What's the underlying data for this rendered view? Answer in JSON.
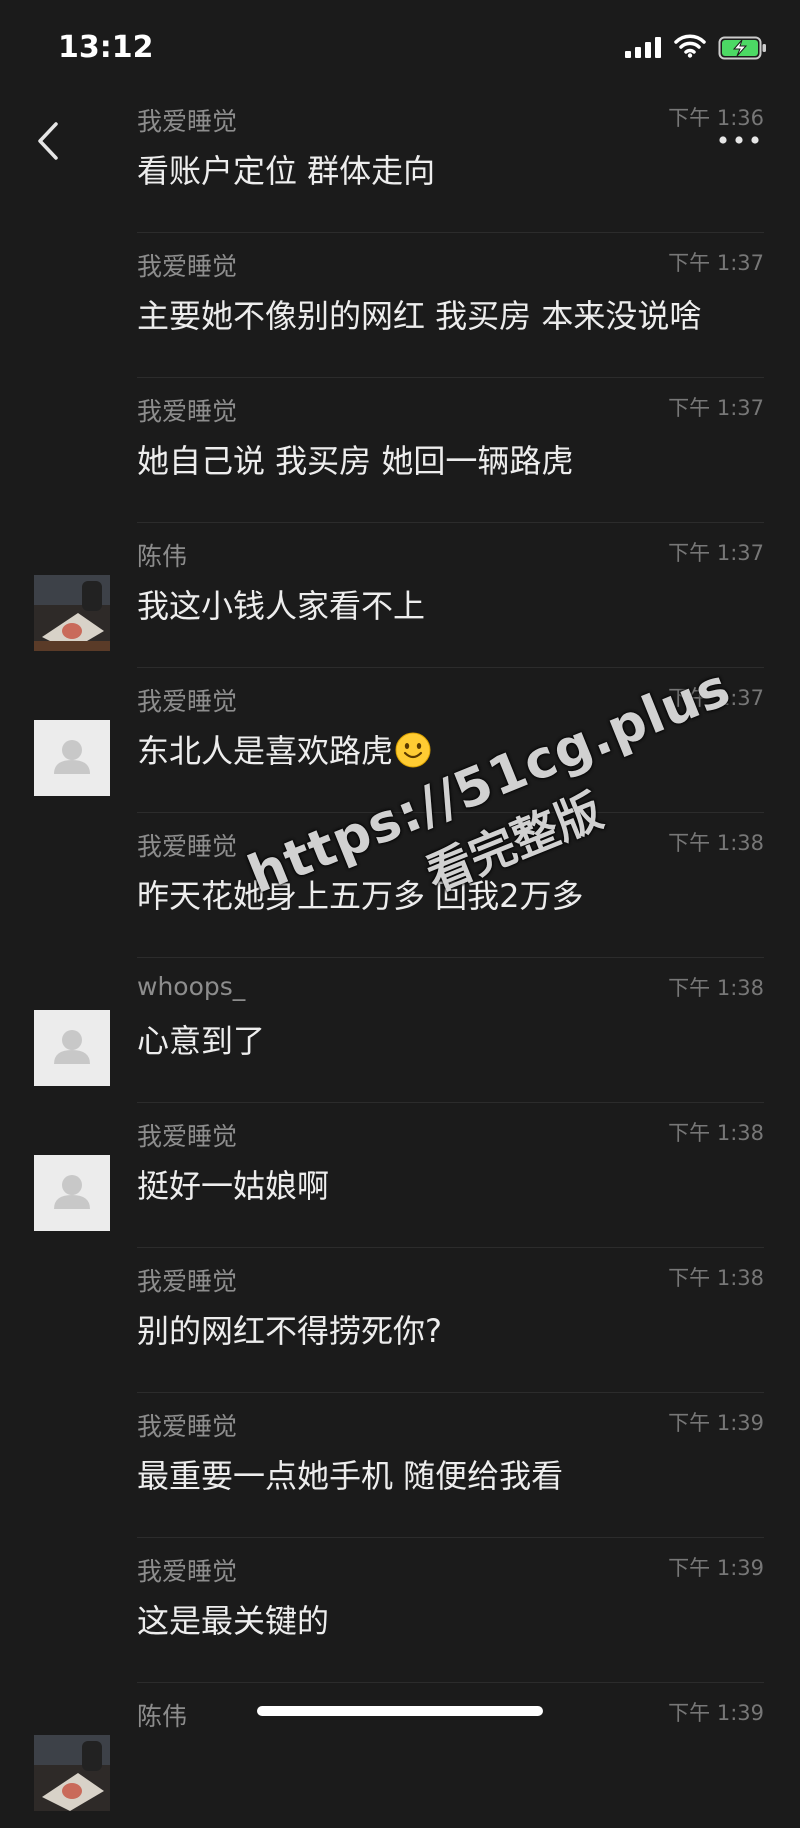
{
  "status_bar": {
    "time": "13:12"
  },
  "header": {
    "back_icon": "chevron-left-icon",
    "more_icon": "more-horizontal-icon"
  },
  "messages": [
    {
      "sender": "我爱睡觉",
      "time": "下午 1:36",
      "text": "看账户定位 群体走向",
      "avatar": "none"
    },
    {
      "sender": "我爱睡觉",
      "time": "下午 1:37",
      "text": "主要她不像别的网红 我买房 本来没说啥",
      "avatar": "none"
    },
    {
      "sender": "我爱睡觉",
      "time": "下午 1:37",
      "text": "她自己说 我买房 她回一辆路虎",
      "avatar": "none"
    },
    {
      "sender": "陈伟",
      "time": "下午 1:37",
      "text": "我这小钱人家看不上",
      "avatar": "photo"
    },
    {
      "sender": "我爱睡觉",
      "time": "下午 1:37",
      "text": "东北人是喜欢路虎",
      "avatar": "default",
      "emoji": "smiling-face-icon"
    },
    {
      "sender": "我爱睡觉",
      "time": "下午 1:38",
      "text": "昨天花她身上五万多 回我2万多",
      "avatar": "none"
    },
    {
      "sender": "whoops_",
      "time": "下午 1:38",
      "text": "心意到了",
      "avatar": "default"
    },
    {
      "sender": "我爱睡觉",
      "time": "下午 1:38",
      "text": "挺好一姑娘啊",
      "avatar": "default"
    },
    {
      "sender": "我爱睡觉",
      "time": "下午 1:38",
      "text": "别的网红不得捞死你?",
      "avatar": "none"
    },
    {
      "sender": "我爱睡觉",
      "time": "下午 1:39",
      "text": "最重要一点她手机 随便给我看",
      "avatar": "none"
    },
    {
      "sender": "我爱睡觉",
      "time": "下午 1:39",
      "text": "这是最关键的",
      "avatar": "none"
    },
    {
      "sender": "陈伟",
      "time": "下午 1:39",
      "text": "",
      "avatar": "photo"
    }
  ],
  "watermark": {
    "url": "https://51cg.plus",
    "text": "看完整版"
  }
}
